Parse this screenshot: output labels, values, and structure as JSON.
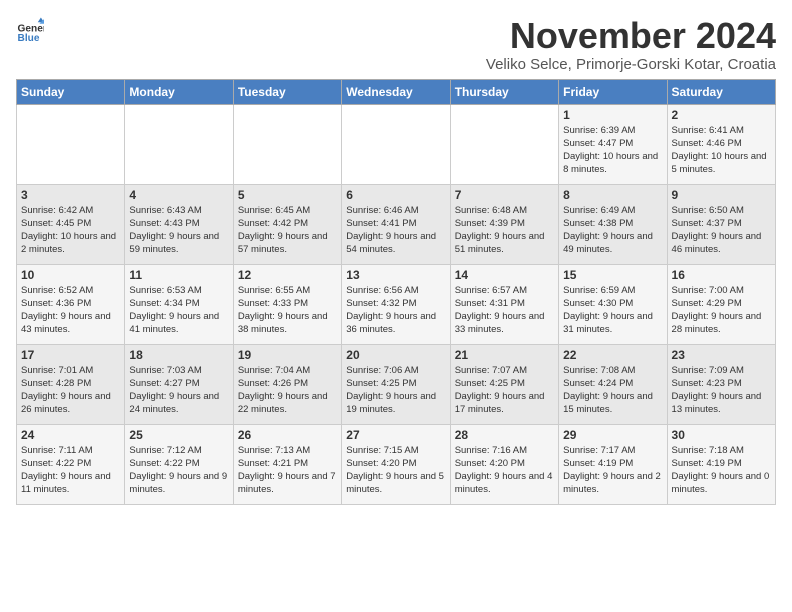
{
  "logo": {
    "general": "General",
    "blue": "Blue"
  },
  "title": "November 2024",
  "location": "Veliko Selce, Primorje-Gorski Kotar, Croatia",
  "days_of_week": [
    "Sunday",
    "Monday",
    "Tuesday",
    "Wednesday",
    "Thursday",
    "Friday",
    "Saturday"
  ],
  "weeks": [
    [
      {
        "day": "",
        "info": ""
      },
      {
        "day": "",
        "info": ""
      },
      {
        "day": "",
        "info": ""
      },
      {
        "day": "",
        "info": ""
      },
      {
        "day": "",
        "info": ""
      },
      {
        "day": "1",
        "info": "Sunrise: 6:39 AM\nSunset: 4:47 PM\nDaylight: 10 hours and 8 minutes."
      },
      {
        "day": "2",
        "info": "Sunrise: 6:41 AM\nSunset: 4:46 PM\nDaylight: 10 hours and 5 minutes."
      }
    ],
    [
      {
        "day": "3",
        "info": "Sunrise: 6:42 AM\nSunset: 4:45 PM\nDaylight: 10 hours and 2 minutes."
      },
      {
        "day": "4",
        "info": "Sunrise: 6:43 AM\nSunset: 4:43 PM\nDaylight: 9 hours and 59 minutes."
      },
      {
        "day": "5",
        "info": "Sunrise: 6:45 AM\nSunset: 4:42 PM\nDaylight: 9 hours and 57 minutes."
      },
      {
        "day": "6",
        "info": "Sunrise: 6:46 AM\nSunset: 4:41 PM\nDaylight: 9 hours and 54 minutes."
      },
      {
        "day": "7",
        "info": "Sunrise: 6:48 AM\nSunset: 4:39 PM\nDaylight: 9 hours and 51 minutes."
      },
      {
        "day": "8",
        "info": "Sunrise: 6:49 AM\nSunset: 4:38 PM\nDaylight: 9 hours and 49 minutes."
      },
      {
        "day": "9",
        "info": "Sunrise: 6:50 AM\nSunset: 4:37 PM\nDaylight: 9 hours and 46 minutes."
      }
    ],
    [
      {
        "day": "10",
        "info": "Sunrise: 6:52 AM\nSunset: 4:36 PM\nDaylight: 9 hours and 43 minutes."
      },
      {
        "day": "11",
        "info": "Sunrise: 6:53 AM\nSunset: 4:34 PM\nDaylight: 9 hours and 41 minutes."
      },
      {
        "day": "12",
        "info": "Sunrise: 6:55 AM\nSunset: 4:33 PM\nDaylight: 9 hours and 38 minutes."
      },
      {
        "day": "13",
        "info": "Sunrise: 6:56 AM\nSunset: 4:32 PM\nDaylight: 9 hours and 36 minutes."
      },
      {
        "day": "14",
        "info": "Sunrise: 6:57 AM\nSunset: 4:31 PM\nDaylight: 9 hours and 33 minutes."
      },
      {
        "day": "15",
        "info": "Sunrise: 6:59 AM\nSunset: 4:30 PM\nDaylight: 9 hours and 31 minutes."
      },
      {
        "day": "16",
        "info": "Sunrise: 7:00 AM\nSunset: 4:29 PM\nDaylight: 9 hours and 28 minutes."
      }
    ],
    [
      {
        "day": "17",
        "info": "Sunrise: 7:01 AM\nSunset: 4:28 PM\nDaylight: 9 hours and 26 minutes."
      },
      {
        "day": "18",
        "info": "Sunrise: 7:03 AM\nSunset: 4:27 PM\nDaylight: 9 hours and 24 minutes."
      },
      {
        "day": "19",
        "info": "Sunrise: 7:04 AM\nSunset: 4:26 PM\nDaylight: 9 hours and 22 minutes."
      },
      {
        "day": "20",
        "info": "Sunrise: 7:06 AM\nSunset: 4:25 PM\nDaylight: 9 hours and 19 minutes."
      },
      {
        "day": "21",
        "info": "Sunrise: 7:07 AM\nSunset: 4:25 PM\nDaylight: 9 hours and 17 minutes."
      },
      {
        "day": "22",
        "info": "Sunrise: 7:08 AM\nSunset: 4:24 PM\nDaylight: 9 hours and 15 minutes."
      },
      {
        "day": "23",
        "info": "Sunrise: 7:09 AM\nSunset: 4:23 PM\nDaylight: 9 hours and 13 minutes."
      }
    ],
    [
      {
        "day": "24",
        "info": "Sunrise: 7:11 AM\nSunset: 4:22 PM\nDaylight: 9 hours and 11 minutes."
      },
      {
        "day": "25",
        "info": "Sunrise: 7:12 AM\nSunset: 4:22 PM\nDaylight: 9 hours and 9 minutes."
      },
      {
        "day": "26",
        "info": "Sunrise: 7:13 AM\nSunset: 4:21 PM\nDaylight: 9 hours and 7 minutes."
      },
      {
        "day": "27",
        "info": "Sunrise: 7:15 AM\nSunset: 4:20 PM\nDaylight: 9 hours and 5 minutes."
      },
      {
        "day": "28",
        "info": "Sunrise: 7:16 AM\nSunset: 4:20 PM\nDaylight: 9 hours and 4 minutes."
      },
      {
        "day": "29",
        "info": "Sunrise: 7:17 AM\nSunset: 4:19 PM\nDaylight: 9 hours and 2 minutes."
      },
      {
        "day": "30",
        "info": "Sunrise: 7:18 AM\nSunset: 4:19 PM\nDaylight: 9 hours and 0 minutes."
      }
    ]
  ]
}
